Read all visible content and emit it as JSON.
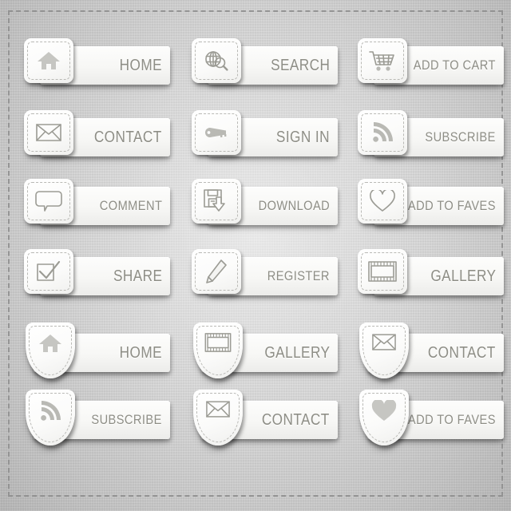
{
  "page": {
    "title": "Button Icon Set",
    "background_color": "#c9c9c9",
    "label_color": "#8e8e86",
    "icon_color": "#9b9b94",
    "border_style": "dashed"
  },
  "rows": [
    {
      "style": "tile",
      "buttons": [
        {
          "label": "HOME",
          "icon": "home-icon"
        },
        {
          "label": "SEARCH",
          "icon": "globe-search-icon"
        },
        {
          "label": "ADD TO CART",
          "icon": "shopping-cart-icon"
        }
      ]
    },
    {
      "style": "tile",
      "buttons": [
        {
          "label": "CONTACT",
          "icon": "envelope-icon"
        },
        {
          "label": "SIGN IN",
          "icon": "key-icon"
        },
        {
          "label": "SUBSCRIBE",
          "icon": "rss-icon"
        }
      ]
    },
    {
      "style": "tile",
      "buttons": [
        {
          "label": "COMMENT",
          "icon": "speech-bubble-icon"
        },
        {
          "label": "DOWNLOAD",
          "icon": "floppy-download-icon"
        },
        {
          "label": "ADD TO FAVES",
          "icon": "heart-outline-icon"
        }
      ]
    },
    {
      "style": "tile",
      "buttons": [
        {
          "label": "SHARE",
          "icon": "checkbox-check-icon"
        },
        {
          "label": "REGISTER",
          "icon": "pencil-icon"
        },
        {
          "label": "GALLERY",
          "icon": "filmstrip-icon"
        }
      ]
    },
    {
      "style": "shield",
      "buttons": [
        {
          "label": "HOME",
          "icon": "home-icon"
        },
        {
          "label": "GALLERY",
          "icon": "filmstrip-icon"
        },
        {
          "label": "CONTACT",
          "icon": "envelope-icon"
        }
      ]
    },
    {
      "style": "shield",
      "buttons": [
        {
          "label": "SUBSCRIBE",
          "icon": "rss-icon"
        },
        {
          "label": "CONTACT",
          "icon": "envelope-icon"
        },
        {
          "label": "ADD TO FAVES",
          "icon": "heart-filled-icon"
        }
      ]
    }
  ]
}
